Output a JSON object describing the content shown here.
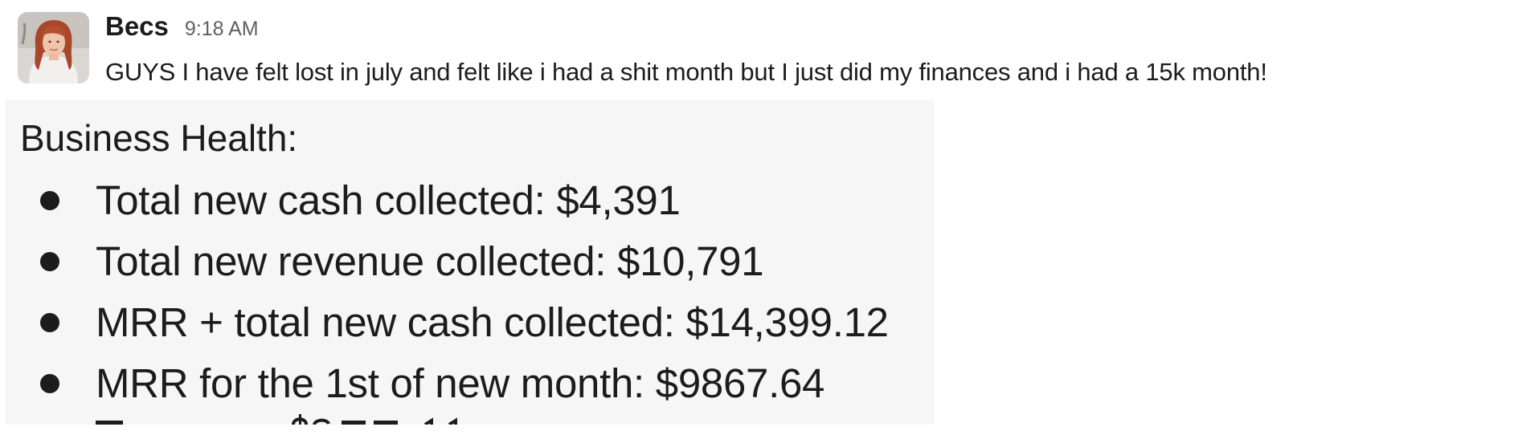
{
  "message": {
    "author": "Becs",
    "timestamp": "9:18 AM",
    "text": "GUYS I have felt lost in july and felt like i had a shit month but I just did my finances and i had a 15k month!"
  },
  "attachment": {
    "title": "Business Health:",
    "items": [
      "Total new cash collected: $4,391",
      "Total new revenue collected: $10,791",
      "MRR + total new cash collected: $14,399.12",
      "MRR for the 1st of new month: $9867.64"
    ]
  },
  "icons": {
    "avatar": "user-avatar-photo",
    "bullet": "bullet-dot"
  },
  "colors": {
    "text": "#1d1c1d",
    "timestamp": "#616061",
    "attachment_bg": "#f6f6f6"
  }
}
